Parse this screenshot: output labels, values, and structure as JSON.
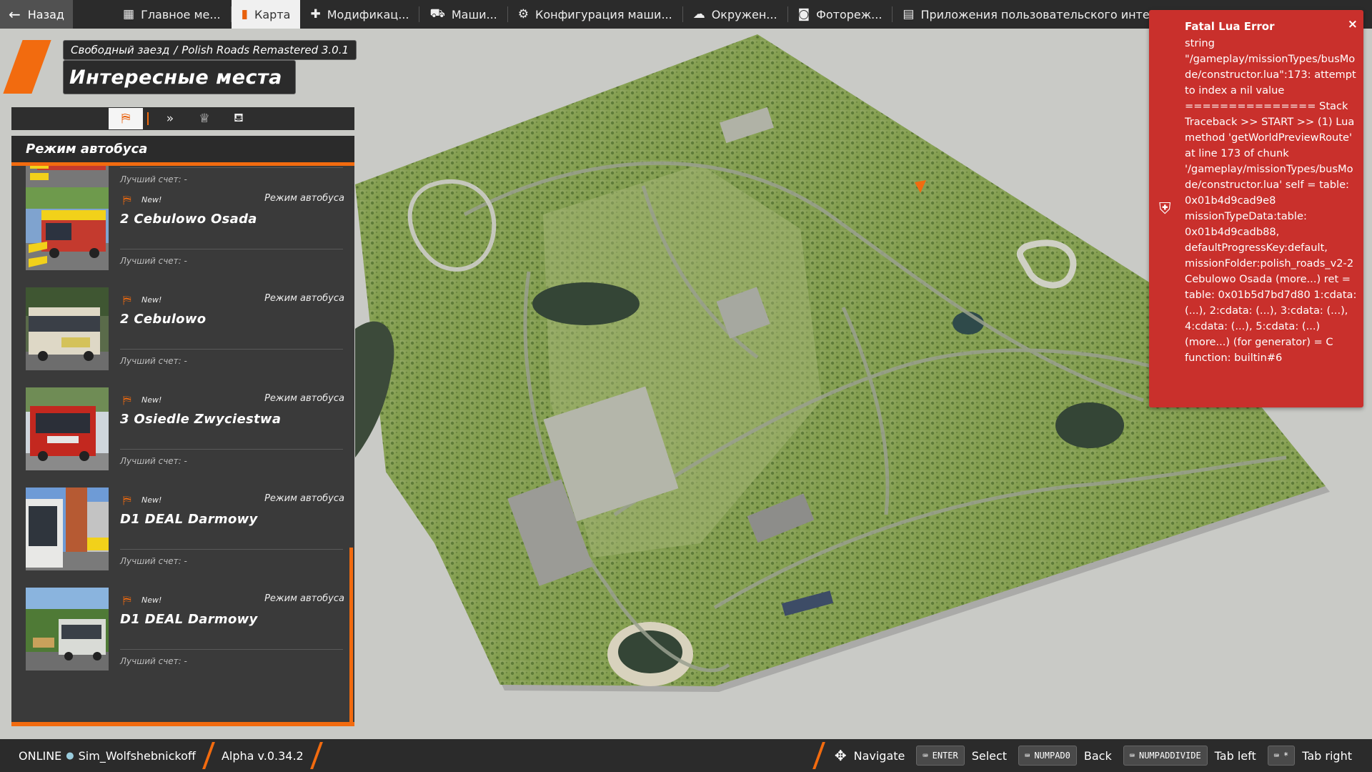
{
  "topbar": {
    "back_label": "Назад",
    "tabs": [
      {
        "label": "Главное ме...",
        "icon": "grid-icon"
      },
      {
        "label": "Карта",
        "icon": "map-icon",
        "active": true
      },
      {
        "label": "Модификац...",
        "icon": "puzzle-icon"
      },
      {
        "label": "Маши...",
        "icon": "car-icon"
      },
      {
        "label": "Конфигурация маши...",
        "icon": "engine-icon"
      },
      {
        "label": "Окружен...",
        "icon": "weather-icon"
      },
      {
        "label": "Фотореж...",
        "icon": "camera-icon"
      },
      {
        "label": "Приложения пользовательского интерфе...",
        "icon": "app-icon"
      }
    ]
  },
  "header": {
    "breadcrumb_part1": "Свободный заезд",
    "breadcrumb_sep": "/",
    "breadcrumb_part2": "Polish Roads Remastered 3.0.1",
    "title": "Интересные места"
  },
  "filters": [
    {
      "icon": "bus-stop-icon",
      "active": true
    },
    {
      "icon": "chevrons-right-icon"
    },
    {
      "icon": "trophy-icon"
    },
    {
      "icon": "bus-stop-add-icon"
    }
  ],
  "panel": {
    "heading": "Режим автобуса",
    "items": [
      {
        "title": "",
        "type": "",
        "new": "",
        "score": "Лучший счет: -",
        "thumb": "bus-red-yellow"
      },
      {
        "title": "2 Cebulowo Osada",
        "type": "Режим автобуса",
        "new": "New!",
        "score": "Лучший счет: -",
        "thumb": "bus-red-yellow"
      },
      {
        "title": "2 Cebulowo",
        "type": "Режим автобуса",
        "new": "New!",
        "score": "Лучший счет: -",
        "thumb": "bus-white"
      },
      {
        "title": "3 Osiedle Zwyciestwa",
        "type": "Режим автобуса",
        "new": "New!",
        "score": "Лучший счет: -",
        "thumb": "bus-red"
      },
      {
        "title": "D1 DEAL Darmowy",
        "type": "Режим автобуса",
        "new": "New!",
        "score": "Лучший счет: -",
        "thumb": "bus-city"
      },
      {
        "title": "D1 DEAL Darmowy",
        "type": "Режим автобуса",
        "new": "New!",
        "score": "Лучший счет: -",
        "thumb": "bus-green"
      }
    ]
  },
  "error": {
    "title": "Fatal Lua Error",
    "close": "×",
    "message": "string \"/gameplay/missionTypes/busMode/constructor.lua\":173: attempt to index a nil value =============== Stack Traceback >> START >> (1) Lua method 'getWorldPreviewRoute' at line 173 of chunk '/gameplay/missionTypes/busMode/constructor.lua' self = table: 0x01b4d9cad9e8 missionTypeData:table: 0x01b4d9cadb88, defaultProgressKey:default, missionFolder:polish_roads_v2-2 Cebulowo Osada (more...) ret = table: 0x01b5d7bd7d80 1:cdata: (...), 2:cdata: (...), 3:cdata: (...), 4:cdata: (...), 5:cdata: (...) (more...) (for generator) = C function: builtin#6"
  },
  "bottombar": {
    "online": "ONLINE",
    "username": "Sim_Wolfshebnickoff",
    "version": "Alpha v.0.34.2",
    "hints": [
      {
        "key": "",
        "label": "Navigate",
        "icon": "dpad-icon"
      },
      {
        "key": "ENTER",
        "label": "Select"
      },
      {
        "key": "NUMPAD0",
        "label": "Back"
      },
      {
        "key": "NUMPADDIVIDE",
        "label": "Tab left"
      },
      {
        "key": "*",
        "label": "Tab right"
      }
    ]
  },
  "colors": {
    "accent": "#f26b0f",
    "bar": "#2b2b2b",
    "panel": "#3a3a3a",
    "error": "#c9302c",
    "terrain": "#8aa45a"
  }
}
